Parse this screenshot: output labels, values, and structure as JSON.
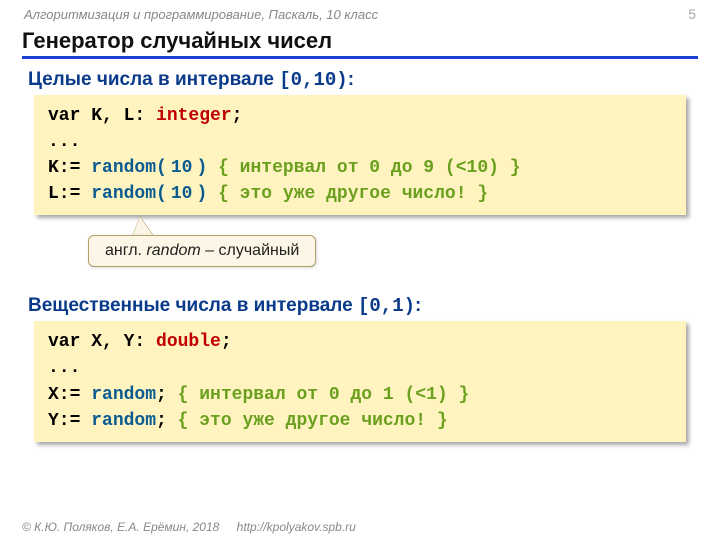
{
  "header": {
    "course_line": "Алгоритмизация и программирование, Паскаль, 10 класс",
    "page_number": "5"
  },
  "title": "Генератор случайных чисел",
  "section1": {
    "label_prefix": "Целые числа в интервале ",
    "interval": "[0,10)",
    "label_suffix": ":",
    "code": {
      "l1a": "var K, L: ",
      "l1_kw": "integer",
      "l1b": ";",
      "l2": "...",
      "l3a": "K:= ",
      "l3_rand": "random(",
      "l3v": "10",
      "l3_rand2": ")",
      "l3_sp": " ",
      "l3cmt": "{ интервал от 0 до 9 (<10) }",
      "l4a": "L:= ",
      "l4_rand": "random(",
      "l4v": "10",
      "l4_rand2": ")",
      "l4_sp": " ",
      "l4cmt": "{ это уже другое число! }"
    }
  },
  "callout": {
    "prefix": "англ. ",
    "em": "random",
    "suffix": " – случайный"
  },
  "section2": {
    "label_prefix": "Вещественные числа в интервале ",
    "interval": "[0,1)",
    "label_suffix": ":",
    "code": {
      "l1a": "var X, Y: ",
      "l1_kw": "double",
      "l1b": ";",
      "l2": "...",
      "l3a": "X:= ",
      "l3_rand": "random",
      "l3b": "; ",
      "l3cmt": "{ интервал от 0 до 1 (<1) }",
      "l4a": "Y:= ",
      "l4_rand": "random",
      "l4b": "; ",
      "l4cmt": "{ это уже другое число! }"
    }
  },
  "footer": {
    "copyright": "© К.Ю. Поляков, Е.А. Ерёмин, 2018",
    "link": "http://kpolyakov.spb.ru"
  }
}
